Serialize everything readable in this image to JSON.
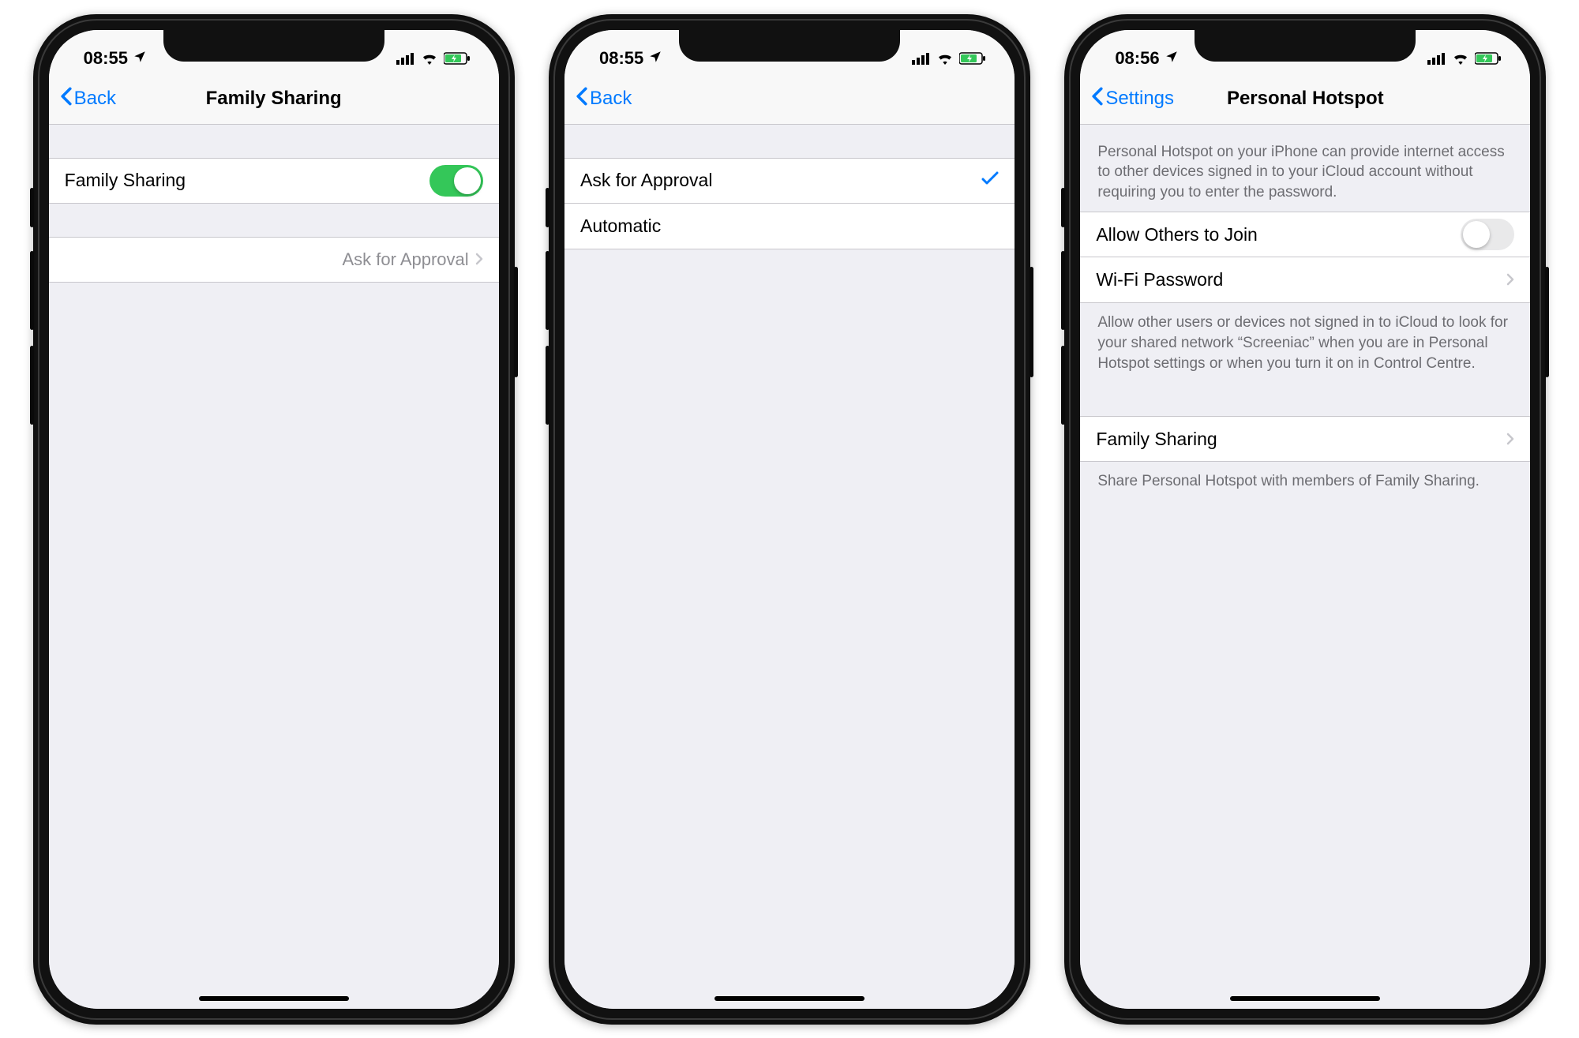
{
  "phone1": {
    "status": {
      "time": "08:55"
    },
    "nav": {
      "back": "Back",
      "title": "Family Sharing"
    },
    "rows": {
      "family_sharing_label": "Family Sharing",
      "ask_for_approval_label": "Ask for Approval"
    }
  },
  "phone2": {
    "status": {
      "time": "08:55"
    },
    "nav": {
      "back": "Back",
      "title": ""
    },
    "rows": {
      "ask_for_approval": "Ask for Approval",
      "automatic": "Automatic"
    }
  },
  "phone3": {
    "status": {
      "time": "08:56"
    },
    "nav": {
      "back": "Settings",
      "title": "Personal Hotspot"
    },
    "header_text": "Personal Hotspot on your iPhone can provide internet access to other devices signed in to your iCloud account without requiring you to enter the password.",
    "rows": {
      "allow_others": "Allow Others to Join",
      "wifi_password": "Wi-Fi Password",
      "family_sharing": "Family Sharing"
    },
    "footer_allow": "Allow other users or devices not signed in to iCloud to look for your shared network “Screeniac” when you are in Personal Hotspot settings or when you turn it on in Control Centre.",
    "footer_family": "Share Personal Hotspot with members of Family Sharing."
  }
}
